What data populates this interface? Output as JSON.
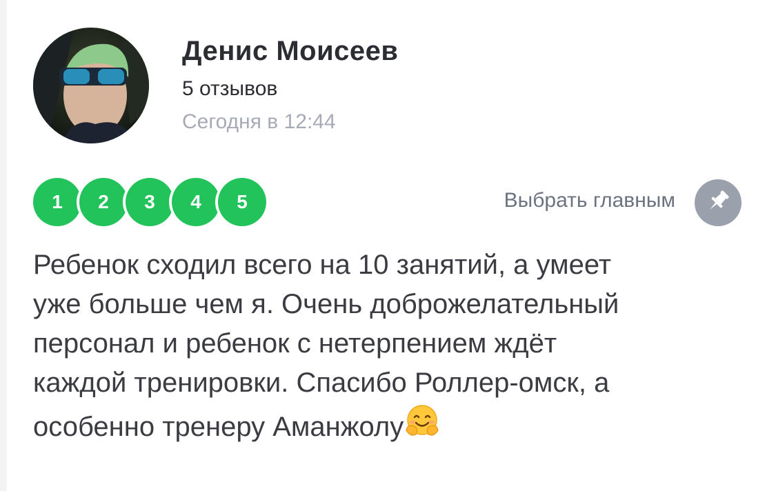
{
  "review": {
    "author": "Денис Моисеев",
    "review_count": "5 отзывов",
    "date": "Сегодня в 12:44",
    "rating_steps": [
      "1",
      "2",
      "3",
      "4",
      "5"
    ],
    "pick_main_label": "Выбрать главным",
    "text_lines": [
      "Ребенок сходил всего на 10 занятий, а умеет",
      "уже больше чем я. Очень доброжелательный",
      "персонал и ребенок с нетерпением ждёт",
      "каждой тренировки. Спасибо Роллер-омск, а",
      "особенно тренеру Аманжолу"
    ],
    "emoji": "hugging-face-emoji"
  },
  "colors": {
    "rating_green": "#22c35b",
    "pin_gray": "#9aa1ad",
    "muted_text": "#a6abb6"
  },
  "icons": {
    "pin": "pushpin-icon"
  }
}
